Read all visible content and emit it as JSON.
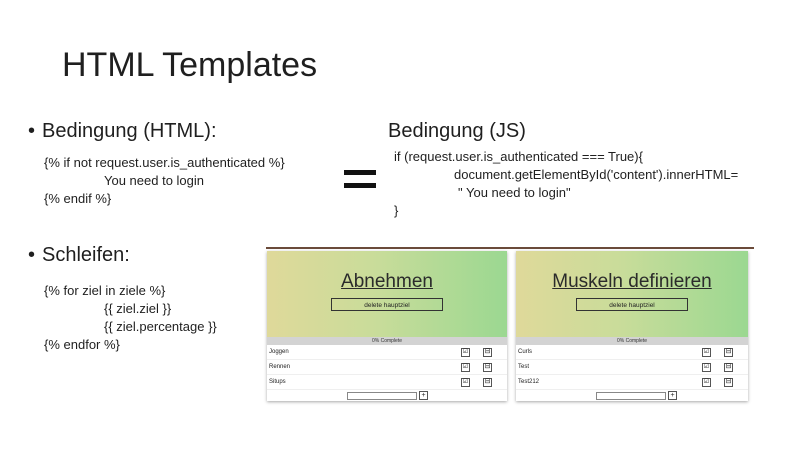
{
  "slide": {
    "title": "HTML Templates"
  },
  "bedingung_html": {
    "heading": "Bedingung (HTML):",
    "lines": [
      "{% if not request.user.is_authenticated %}",
      "You need to login",
      "{% endif %}"
    ]
  },
  "bedingung_js": {
    "heading": "Bedingung (JS)",
    "lines": [
      "if (request.user.is_authenticated === True){",
      "document.getElementById('content').innerHTML=",
      "\" You need to login\"",
      "}"
    ]
  },
  "schleifen": {
    "heading": "Schleifen:",
    "lines": [
      "{% for ziel in ziele %}",
      "{{ ziel.ziel }}",
      "{{ ziel.percentage }}",
      "{% endfor %}"
    ]
  },
  "cards": [
    {
      "title": "Abnehmen",
      "delete_label": "delete hauptziel",
      "progress_text": "0% Complete",
      "items": [
        "Joggen",
        "Rennen",
        "Situps"
      ],
      "add_placeholder": "",
      "plus": "+"
    },
    {
      "title": "Muskeln definieren",
      "delete_label": "delete hauptziel",
      "progress_text": "0% Complete",
      "items": [
        "Curls",
        "Test",
        "Test212"
      ],
      "add_placeholder": "",
      "plus": "+"
    }
  ],
  "icons": {
    "check": "☑",
    "minus": "⊟"
  },
  "colors": {
    "header_left": "#dfd99a",
    "header_right": "#9bd891",
    "rule": "#6b4b3a"
  }
}
